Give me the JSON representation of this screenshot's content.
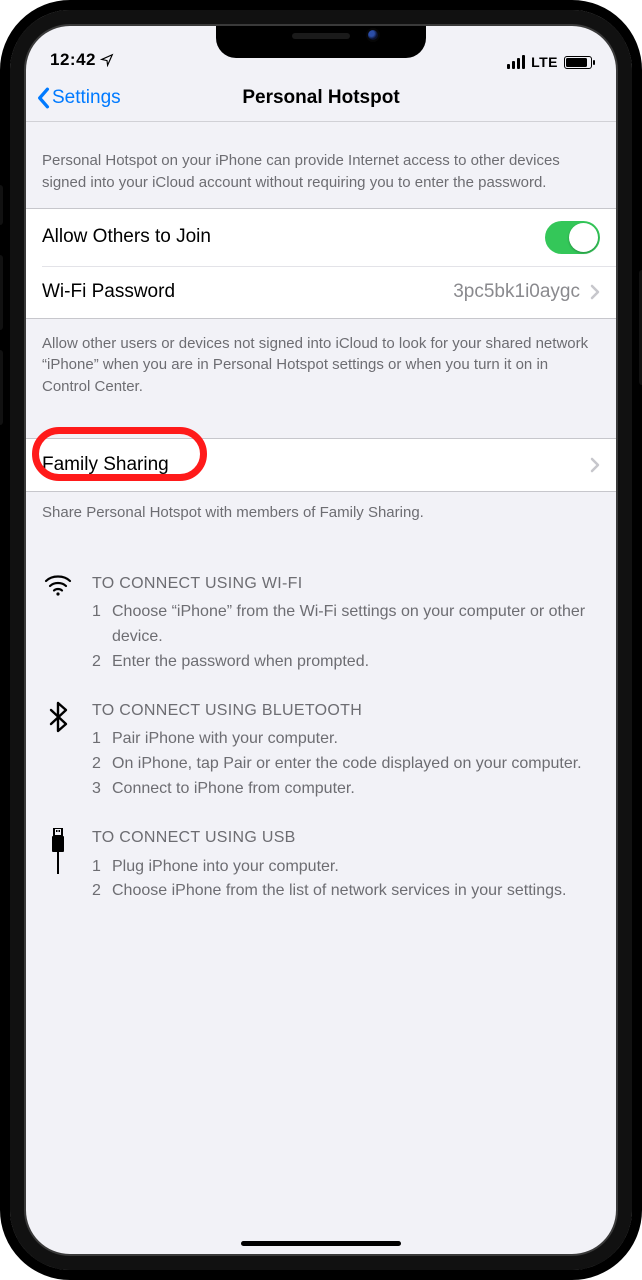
{
  "statusbar": {
    "time": "12:42",
    "carrier_label": "LTE"
  },
  "nav": {
    "back_label": "Settings",
    "title": "Personal Hotspot"
  },
  "section_top_desc": "Personal Hotspot on your iPhone can provide Internet access to other devices signed into your iCloud account without requiring you to enter the password.",
  "rows": {
    "allow_others": {
      "label": "Allow Others to Join",
      "on": true
    },
    "wifi_password": {
      "label": "Wi-Fi Password",
      "value": "3pc5bk1i0aygc"
    },
    "family_sharing": {
      "label": "Family Sharing"
    }
  },
  "allow_footer": "Allow other users or devices not signed into iCloud to look for your shared network “iPhone” when you are in Personal Hotspot settings or when you turn it on in Control Center.",
  "family_footer": "Share Personal Hotspot with members of Family Sharing.",
  "instructions": {
    "wifi": {
      "title": "TO CONNECT USING WI-FI",
      "steps": [
        "Choose “iPhone” from the Wi-Fi settings on your computer or other device.",
        "Enter the password when prompted."
      ]
    },
    "bt": {
      "title": "TO CONNECT USING BLUETOOTH",
      "steps": [
        "Pair iPhone with your computer.",
        "On iPhone, tap Pair or enter the code displayed on your computer.",
        "Connect to iPhone from computer."
      ]
    },
    "usb": {
      "title": "TO CONNECT USING USB",
      "steps": [
        "Plug iPhone into your computer.",
        "Choose iPhone from the list of network services in your settings."
      ]
    }
  }
}
